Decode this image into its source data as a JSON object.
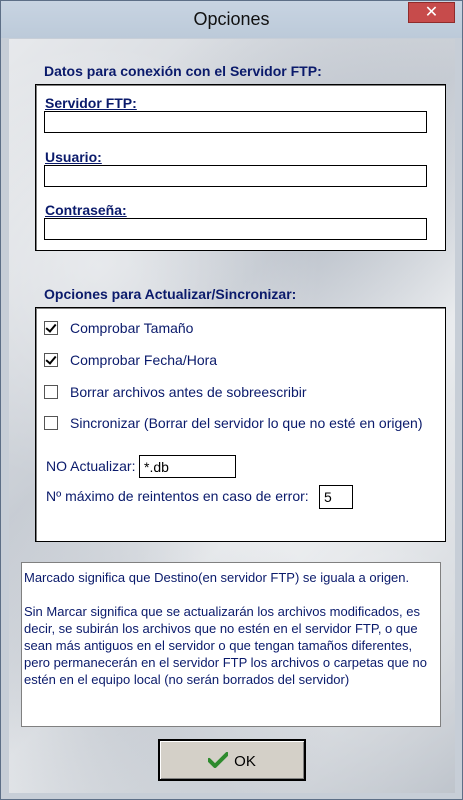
{
  "window": {
    "title": "Opciones",
    "close_label": "✕"
  },
  "ftp": {
    "group_title": "Datos para conexión con el Servidor FTP:",
    "server_label": "Servidor FTP:",
    "server_value": "",
    "user_label": "Usuario:",
    "user_value": "",
    "password_label": "Contraseña:",
    "password_value": ""
  },
  "sync": {
    "group_title": "Opciones para Actualizar/Sincronizar:",
    "options": [
      {
        "label": "Comprobar Tamaño",
        "checked": true
      },
      {
        "label": "Comprobar Fecha/Hora",
        "checked": true
      },
      {
        "label": "Borrar archivos antes de sobreescribir",
        "checked": false
      },
      {
        "label": "Sincronizar (Borrar del servidor lo que no esté en origen)",
        "checked": false
      }
    ],
    "no_update_label": "NO Actualizar:",
    "no_update_value": "*.db",
    "retries_label": "Nº máximo de reintentos en caso de error:",
    "retries_value": "5"
  },
  "info": {
    "paragraph1": "Marcado significa que Destino(en servidor FTP) se iguala a origen.",
    "paragraph2": "Sin Marcar significa que se actualizarán los archivos modificados, es decir, se subirán los archivos que no estén en el servidor FTP, o que sean más antiguos en el servidor o que tengan tamaños diferentes, pero permanecerán en el servidor FTP los archivos o carpetas que no estén en el equipo local (no serán borrados del servidor)"
  },
  "ok_button": {
    "label": "OK",
    "icon": "checkmark-icon",
    "icon_color": "#2e8b2e"
  }
}
